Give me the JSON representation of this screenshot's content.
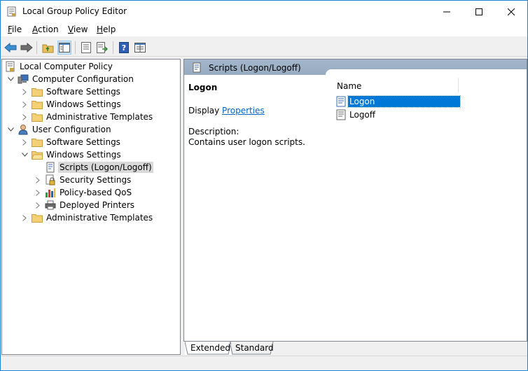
{
  "window": {
    "title": "Local Group Policy Editor"
  },
  "menu": {
    "items": [
      {
        "key": "F",
        "rest": "ile"
      },
      {
        "key": "A",
        "rest": "ction"
      },
      {
        "key": "V",
        "rest": "iew"
      },
      {
        "key": "H",
        "rest": "elp"
      }
    ]
  },
  "tree": {
    "root": "Local Computer Policy",
    "computer_config": "Computer Configuration",
    "cc_software": "Software Settings",
    "cc_windows": "Windows Settings",
    "cc_admin": "Administrative Templates",
    "user_config": "User Configuration",
    "uc_software": "Software Settings",
    "uc_windows": "Windows Settings",
    "scripts": "Scripts (Logon/Logoff)",
    "security": "Security Settings",
    "qos": "Policy-based QoS",
    "printers": "Deployed Printers",
    "uc_admin": "Administrative Templates"
  },
  "right": {
    "header": "Scripts (Logon/Logoff)",
    "ext_title": "Logon",
    "display_prefix": "Display ",
    "display_link": "Properties",
    "desc_label": "Description:",
    "desc_text": "Contains user logon scripts.",
    "list_header": "Name",
    "items": [
      "Logon",
      "Logoff"
    ]
  },
  "tabs": {
    "extended": "Extended",
    "standard": "Standard"
  },
  "colors": {
    "selection": "#0078d7",
    "tree_selection": "#d9d9d9",
    "header_band": "#a3b6cb",
    "link": "#0066cc",
    "window_border": "#1883d7"
  }
}
